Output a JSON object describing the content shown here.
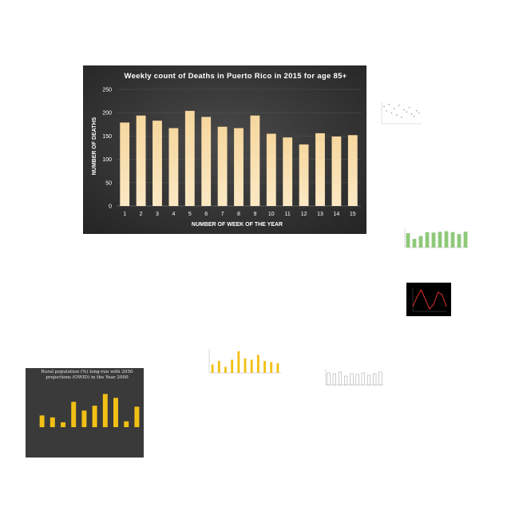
{
  "chart_data": [
    {
      "type": "bar",
      "title": "Weekly count of Deaths in Puerto Rico in 2015 for age 85+",
      "xlabel": "NUMBER OF WEEK OF THE YEAR",
      "ylabel": "NUMBER OF DEATHS",
      "categories": [
        "1",
        "2",
        "3",
        "4",
        "5",
        "6",
        "7",
        "8",
        "9",
        "10",
        "11",
        "12",
        "13",
        "14",
        "15"
      ],
      "values": [
        179,
        194,
        183,
        167,
        204,
        191,
        170,
        167,
        194,
        155,
        147,
        132,
        156,
        149,
        152
      ],
      "ylim": [
        0,
        250
      ],
      "yticks": [
        "0",
        "50",
        "100",
        "150",
        "200",
        "250"
      ],
      "grid": true,
      "colors": {
        "background": "#2e2e2e",
        "bar_top": "#f7d9a3",
        "bar_bottom": "#e9b868",
        "text": "#ffffff",
        "grid": "#505050"
      }
    },
    {
      "type": "scatter",
      "values": [
        0.8,
        0.6,
        0.9,
        0.5,
        0.7,
        0.4,
        0.85,
        0.3,
        0.65,
        0.55,
        0.75,
        0.45,
        0.35,
        0.6,
        0.5
      ],
      "colors": {
        "background": "#ffffff",
        "mark": "#9a9a9a"
      }
    },
    {
      "type": "bar",
      "values": [
        0.75,
        0.45,
        0.6,
        0.8,
        0.78,
        0.82,
        0.85,
        0.8,
        0.7,
        0.83
      ],
      "colors": {
        "background": "#ffffff",
        "mark": "#8fc97a"
      }
    },
    {
      "type": "line",
      "values": [
        0.2,
        0.6,
        0.9,
        0.5,
        0.1,
        0.3,
        0.8,
        0.7,
        0.2
      ],
      "colors": {
        "background": "#000000",
        "mark": "#e03030"
      }
    },
    {
      "type": "bar",
      "values": [
        0.35,
        0.5,
        0.25,
        0.55,
        0.9,
        0.6,
        0.55,
        0.75,
        0.5,
        0.45,
        0.4
      ],
      "colors": {
        "background": "#ffffff",
        "mark": "#f2c014"
      }
    },
    {
      "type": "bar",
      "values": [
        0.75,
        0.7,
        0.8,
        0.55,
        0.7,
        0.65,
        0.75,
        0.6,
        0.7,
        0.8
      ],
      "colors": {
        "background": "#ffffff",
        "mark": "#ffffff",
        "stroke": "#9a9a9a"
      }
    },
    {
      "type": "bar",
      "title": "Rural population (%) long-run with 2050 projections (OWID) in the Year 2000",
      "values": [
        12,
        10,
        5,
        26,
        17,
        22,
        34,
        30,
        6,
        21
      ],
      "colors": {
        "background": "#3a3a3a",
        "mark": "#f2c014",
        "text": "#e8e8e8"
      }
    }
  ]
}
